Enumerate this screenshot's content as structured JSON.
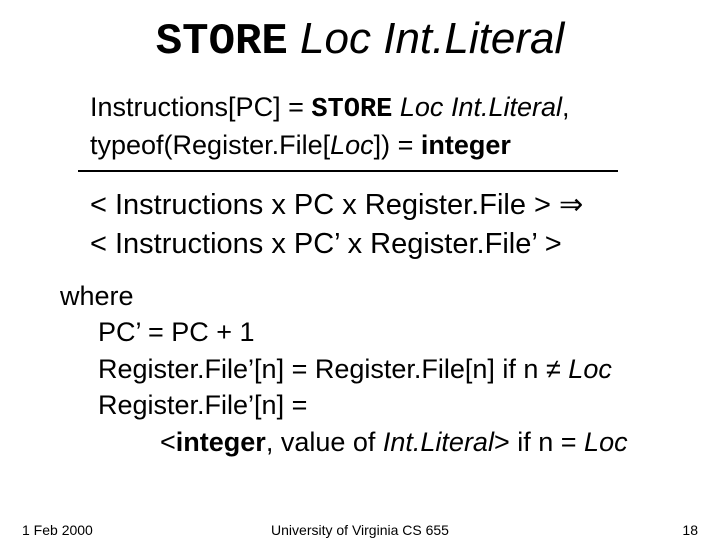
{
  "title": {
    "kw": "STORE",
    "loc": "Loc",
    "lit": "Int.Literal"
  },
  "premise": {
    "line1_a": "Instructions[PC] = ",
    "line1_kw": "STORE",
    "line1_b": " ",
    "line1_loc": "Loc",
    "line1_c": " ",
    "line1_lit": "Int.Literal",
    "line1_d": ",",
    "line2_a": "typeof(Register.File[",
    "line2_loc": "Loc",
    "line2_b": "]) = ",
    "line2_int": "integer"
  },
  "conclusion": {
    "line1": "< Instructions x PC x Register.File > ⇒",
    "line2": "< Instructions x PC’ x Register.File’ >"
  },
  "where": {
    "label": "where",
    "l1": "PC’ = PC + 1",
    "l2_a": "Register.File’[n] = Register.File[n]  if n ",
    "l2_ne": "≠",
    "l2_b": " ",
    "l2_loc": "Loc",
    "l3": "Register.File’[n] =",
    "l4_a": "<",
    "l4_int": "integer",
    "l4_b": ", value of ",
    "l4_lit": "Int.Literal",
    "l4_c": ">  if n ",
    "l4_eq": "=",
    "l4_d": " ",
    "l4_loc": "Loc"
  },
  "footer": {
    "date": "1 Feb 2000",
    "center": "University of Virginia CS 655",
    "num": "18"
  }
}
